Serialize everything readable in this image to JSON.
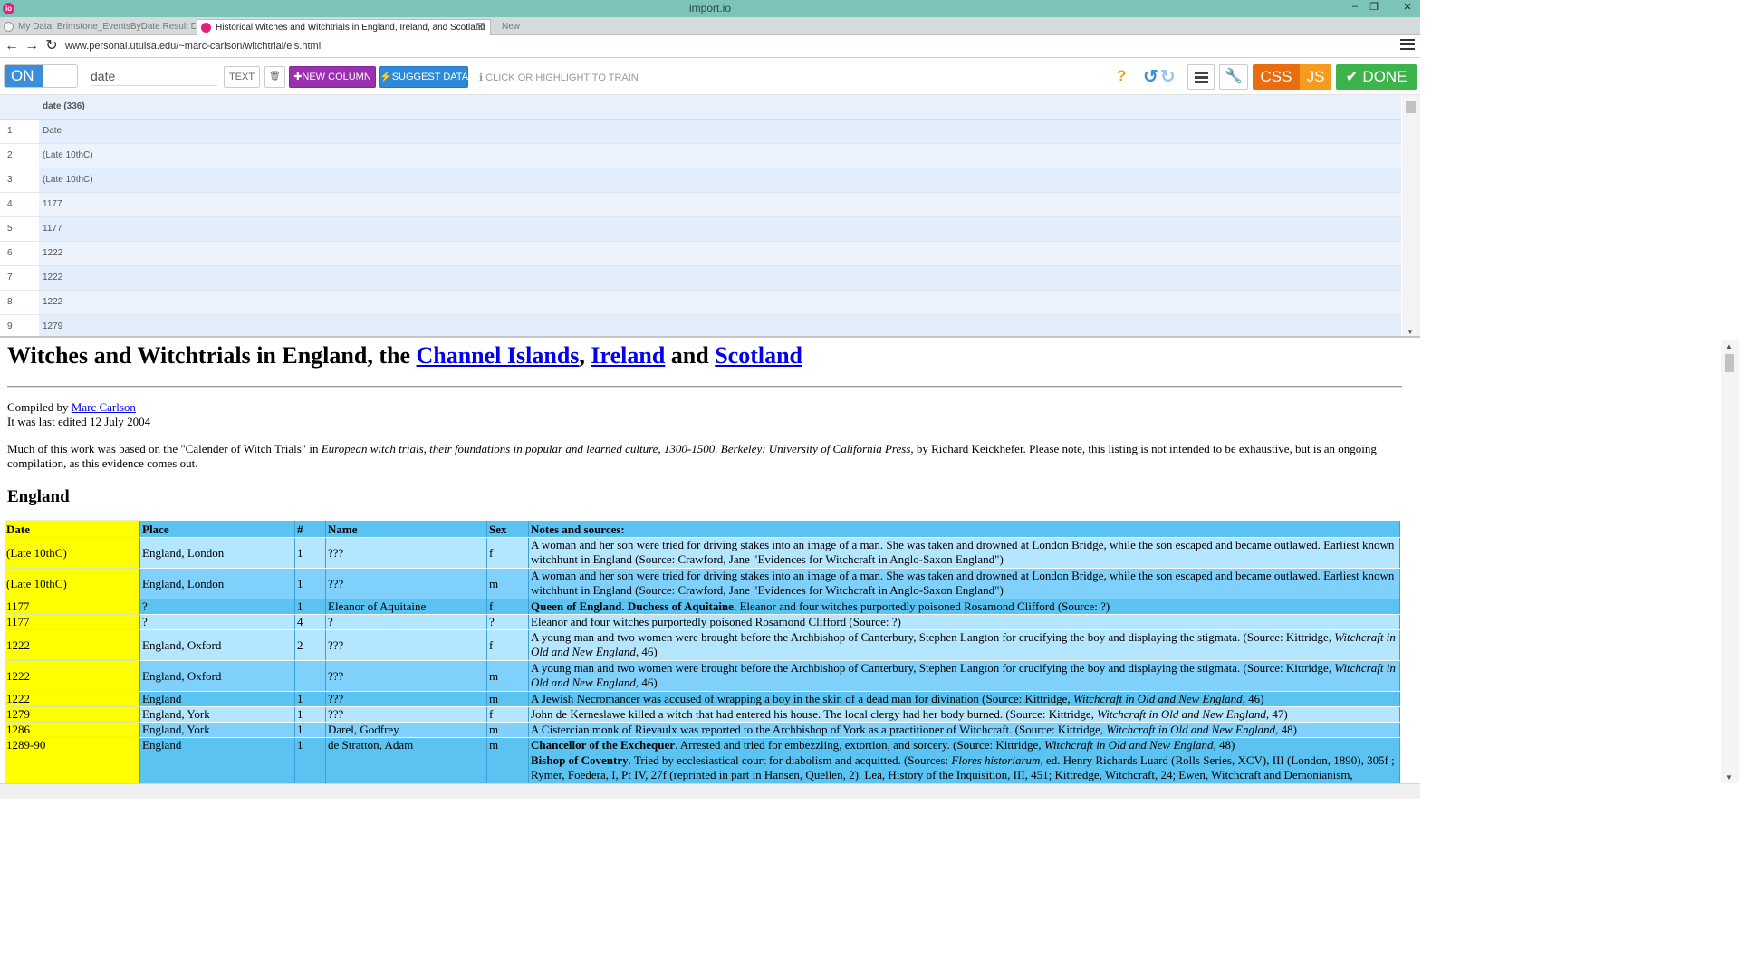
{
  "window": {
    "title": "import.io",
    "minimize": "–",
    "restore": "❐",
    "close": "✕"
  },
  "tabs": [
    {
      "label": "My Data: Brimstone_EventsByDate Result Data"
    },
    {
      "label": "Historical Witches and Witchtrials in England, Ireland, and Scotland",
      "close": "☒"
    },
    {
      "label": "New"
    }
  ],
  "address": {
    "url": "www.personal.utulsa.edu/~marc-carlson/witchtrial/eis.html"
  },
  "toolbar": {
    "toggle_label": "ON",
    "column_name_value": "date",
    "text_label": "TEXT",
    "delete_glyph": "🗑",
    "new_column_label": "✚NEW COLUMN",
    "suggest_label": "⚡SUGGEST DATA",
    "train_hint": "ℹ CLICK OR HIGHLIGHT TO TRAIN",
    "help_glyph": "?",
    "undo_glyph": "↺",
    "redo_glyph": "↻",
    "settings_glyph": "🔧",
    "css_label": "CSS",
    "js_label": "JS",
    "done_label": "✔ DONE"
  },
  "grid": {
    "column_header": "date (336)",
    "rows": [
      {
        "n": "1",
        "v": "Date"
      },
      {
        "n": "2",
        "v": "(Late 10thC)"
      },
      {
        "n": "3",
        "v": "(Late 10thC)"
      },
      {
        "n": "4",
        "v": "1177"
      },
      {
        "n": "5",
        "v": "1177"
      },
      {
        "n": "6",
        "v": "1222"
      },
      {
        "n": "7",
        "v": "1222"
      },
      {
        "n": "8",
        "v": "1222"
      },
      {
        "n": "9",
        "v": "1279"
      }
    ]
  },
  "page": {
    "title_prefix": "Witches and Witchtrials in England, the ",
    "title_link1": "Channel Islands",
    "title_sep1": ", ",
    "title_link2": "Ireland",
    "title_sep2": " and ",
    "title_link3": "Scotland",
    "compiled_by": "Compiled by ",
    "author": "Marc Carlson",
    "last_edited": "It was last edited 12 July 2004",
    "intro_1": "Much of this work was based on the \"Calender of Witch Trials\" in ",
    "intro_book": "European witch trials, their foundations in popular and learned culture, 1300-1500.  Berkeley: University of California Press,",
    "intro_2": " by Richard Keickhefer.  Please note, this listing is not intended to be exhaustive, but is an ongoing",
    "intro_3": "compilation, as this evidence comes out.",
    "section_heading": "England"
  },
  "table": {
    "headers": {
      "date": "Date",
      "place": "Place",
      "num": "#",
      "name": "Name",
      "sex": "Sex",
      "notes": "Notes and sources:"
    },
    "rows": [
      {
        "date": "(Late 10thC)",
        "place": "England, London",
        "num": "1",
        "name": "???",
        "sex": "f",
        "notes": "A woman and her son were tried for driving stakes into an image of a man.  She was taken and drowned at London Bridge, while the son escaped and became outlawed.   Earliest known witchhunt in England (Source: Crawford, Jane  \"Evidences for Witchcraft in Anglo-Saxon England\")"
      },
      {
        "date": "(Late 10thC)",
        "place": "England, London",
        "num": "1",
        "name": "???",
        "sex": "m",
        "notes": "A woman and her son were tried for driving stakes into an image of a man.  She was taken and drowned at London Bridge, while the son escaped and became outlawed.   Earliest known witchhunt in England (Source: Crawford, Jane  \"Evidences for Witchcraft in Anglo-Saxon England\")"
      },
      {
        "date": "1177",
        "place": "?",
        "num": "1",
        "name": "Eleanor of Aquitaine",
        "sex": "f",
        "notes_bold": "Queen of England.  Duchess of Aquitaine.",
        "notes": " Eleanor and four witches purportedly poisoned Rosamond Clifford (Source: ?)"
      },
      {
        "date": "1177",
        "place": "?",
        "num": "4",
        "name": "?",
        "sex": "?",
        "notes": "Eleanor and four witches purportedly poisoned Rosamond Clifford (Source: ?)"
      },
      {
        "date": "1222",
        "place": "England, Oxford",
        "num": "2",
        "name": "???",
        "sex": "f",
        "notes": "A young man and two women were brought before the Archbishop of Canterbury, Stephen Langton for crucifying the boy and displaying the stigmata. (Source: Kittridge, ",
        "notes_italic": "Witchcraft in Old and New England",
        "notes_end": ", 46)"
      },
      {
        "date": "1222",
        "place": "England, Oxford",
        "num": "",
        "name": "???",
        "sex": "m",
        "notes": "A young man and two women were brought before the Archbishop of Canterbury, Stephen Langton for crucifying the boy and displaying the stigmata. (Source: Kittridge, ",
        "notes_italic": "Witchcraft in Old and New England",
        "notes_end": ", 46)"
      },
      {
        "date": "1222",
        "place": "England",
        "num": "1",
        "name": "???",
        "sex": "m",
        "notes": "A Jewish Necromancer was accused of wrapping a boy in the skin of a dead man for divination (Source: Kittridge, ",
        "notes_italic": "Witchcraft in Old and New England",
        "notes_end": ", 46)"
      },
      {
        "date": "1279",
        "place": "England, York",
        "num": "1",
        "name": "???",
        "sex": "f",
        "notes": "John de Kerneslawe killed a witch that had entered his house.  The local clergy had her body burned. (Source: Kittridge, ",
        "notes_italic": "Witchcraft in Old and New England",
        "notes_end": ", 47)"
      },
      {
        "date": "1286",
        "place": "England, York",
        "num": "1",
        "name": "Darel, Godfrey",
        "sex": "m",
        "notes": "A Cistercian monk of Rievaulx was reported to the Archbishop of York as a practitioner of Witchcraft. (Source: Kittridge, ",
        "notes_italic": "Witchcraft in Old and New England",
        "notes_end": ", 48)"
      },
      {
        "date": "1289-90",
        "place": "England",
        "num": "1",
        "name": "de Stratton, Adam",
        "sex": "m",
        "notes_bold": "Chancellor of the Exchequer",
        "notes": ".  Arrested and tried for embezzling, extortion, and sorcery. (Source: Kittridge, ",
        "notes_italic": "Witchcraft in Old and New England",
        "notes_end": ", 48)"
      },
      {
        "date": "",
        "place": "",
        "num": "",
        "name": "",
        "sex": "",
        "notes_bold": "Bishop of Coventry",
        "notes": ".  Tried by ecclesiastical court for diabolism and acquitted.   (Sources: ",
        "notes_italic": "Flores historiarum",
        "notes_end": ", ed.  Henry Richards Luard (Rolls Series, XCV), III (London, 1890), 305f ; Rymer, Foedera, I, Pt IV, 27f (reprinted in part in Hansen, Quellen, 2). Lea, History of the Inquisition, III, 451; Kittredge, Witchcraft, 24; Ewen, Witchcraft and Demonianism,"
      }
    ]
  }
}
